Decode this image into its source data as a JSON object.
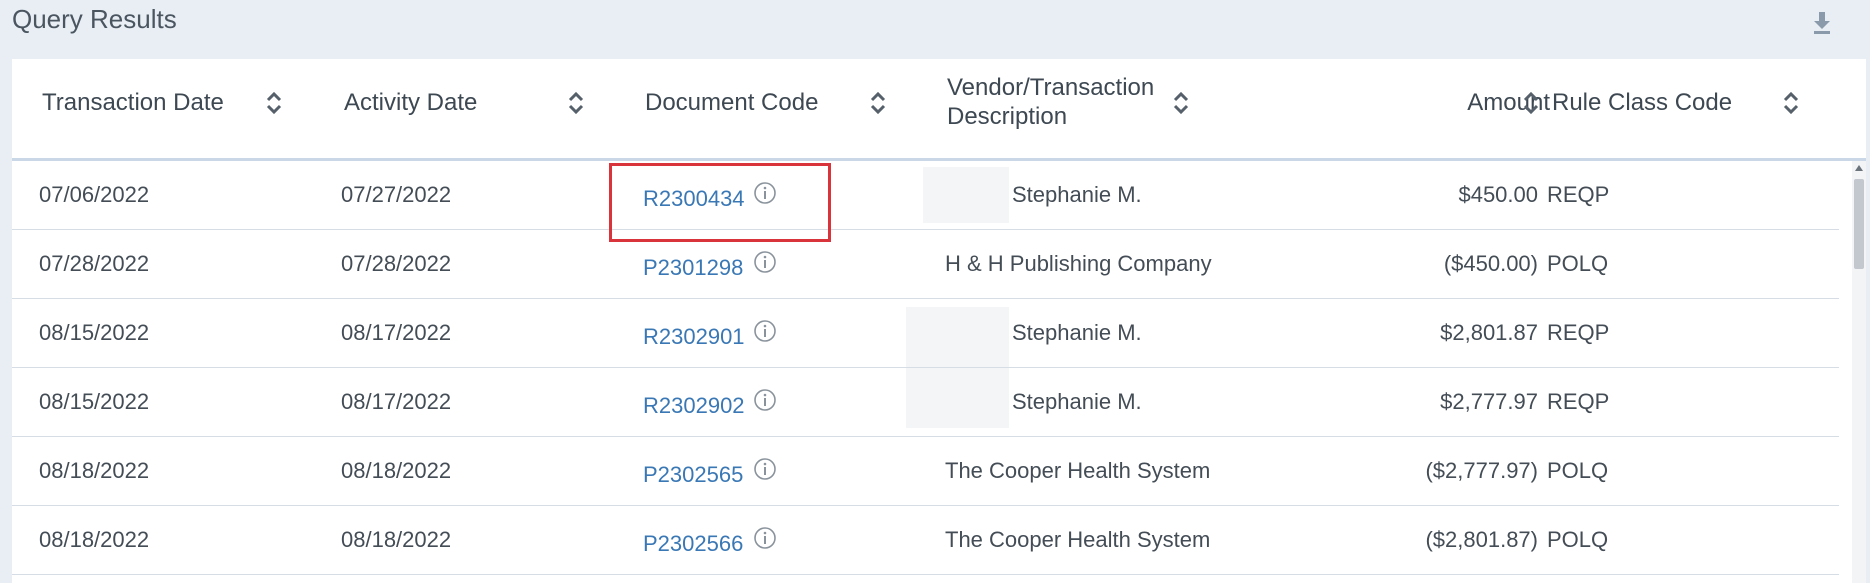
{
  "header": {
    "title": "Query Results",
    "download_icon": "download-icon"
  },
  "table": {
    "columns": [
      {
        "key": "transaction_date",
        "label": "Transaction Date"
      },
      {
        "key": "activity_date",
        "label": "Activity Date"
      },
      {
        "key": "document_code",
        "label": "Document Code"
      },
      {
        "key": "vendor",
        "label_line1": "Vendor/Transaction",
        "label_line2": "Description"
      },
      {
        "key": "amount",
        "label": "Amount"
      },
      {
        "key": "rule_class_code",
        "label": "Rule Class Code"
      }
    ],
    "rows": [
      {
        "transaction_date": "07/06/2022",
        "activity_date": "07/27/2022",
        "document_code": "R2300434",
        "vendor": "Stephanie M.",
        "amount": "$450.00",
        "rule_class_code": "REQP"
      },
      {
        "transaction_date": "07/28/2022",
        "activity_date": "07/28/2022",
        "document_code": "P2301298",
        "vendor": "H & H Publishing Company",
        "amount": "($450.00)",
        "rule_class_code": "POLQ"
      },
      {
        "transaction_date": "08/15/2022",
        "activity_date": "08/17/2022",
        "document_code": "R2302901",
        "vendor": "Stephanie M.",
        "amount": "$2,801.87",
        "rule_class_code": "REQP"
      },
      {
        "transaction_date": "08/15/2022",
        "activity_date": "08/17/2022",
        "document_code": "R2302902",
        "vendor": "Stephanie M.",
        "amount": "$2,777.97",
        "rule_class_code": "REQP"
      },
      {
        "transaction_date": "08/18/2022",
        "activity_date": "08/18/2022",
        "document_code": "P2302565",
        "vendor": "The Cooper Health System",
        "amount": "($2,777.97)",
        "rule_class_code": "POLQ"
      },
      {
        "transaction_date": "08/18/2022",
        "activity_date": "08/18/2022",
        "document_code": "P2302566",
        "vendor": "The Cooper Health System",
        "amount": "($2,801.87)",
        "rule_class_code": "POLQ"
      }
    ]
  },
  "colors": {
    "link": "#3a78b5",
    "highlight": "#d9333b",
    "header_border": "#c9d7e6"
  }
}
